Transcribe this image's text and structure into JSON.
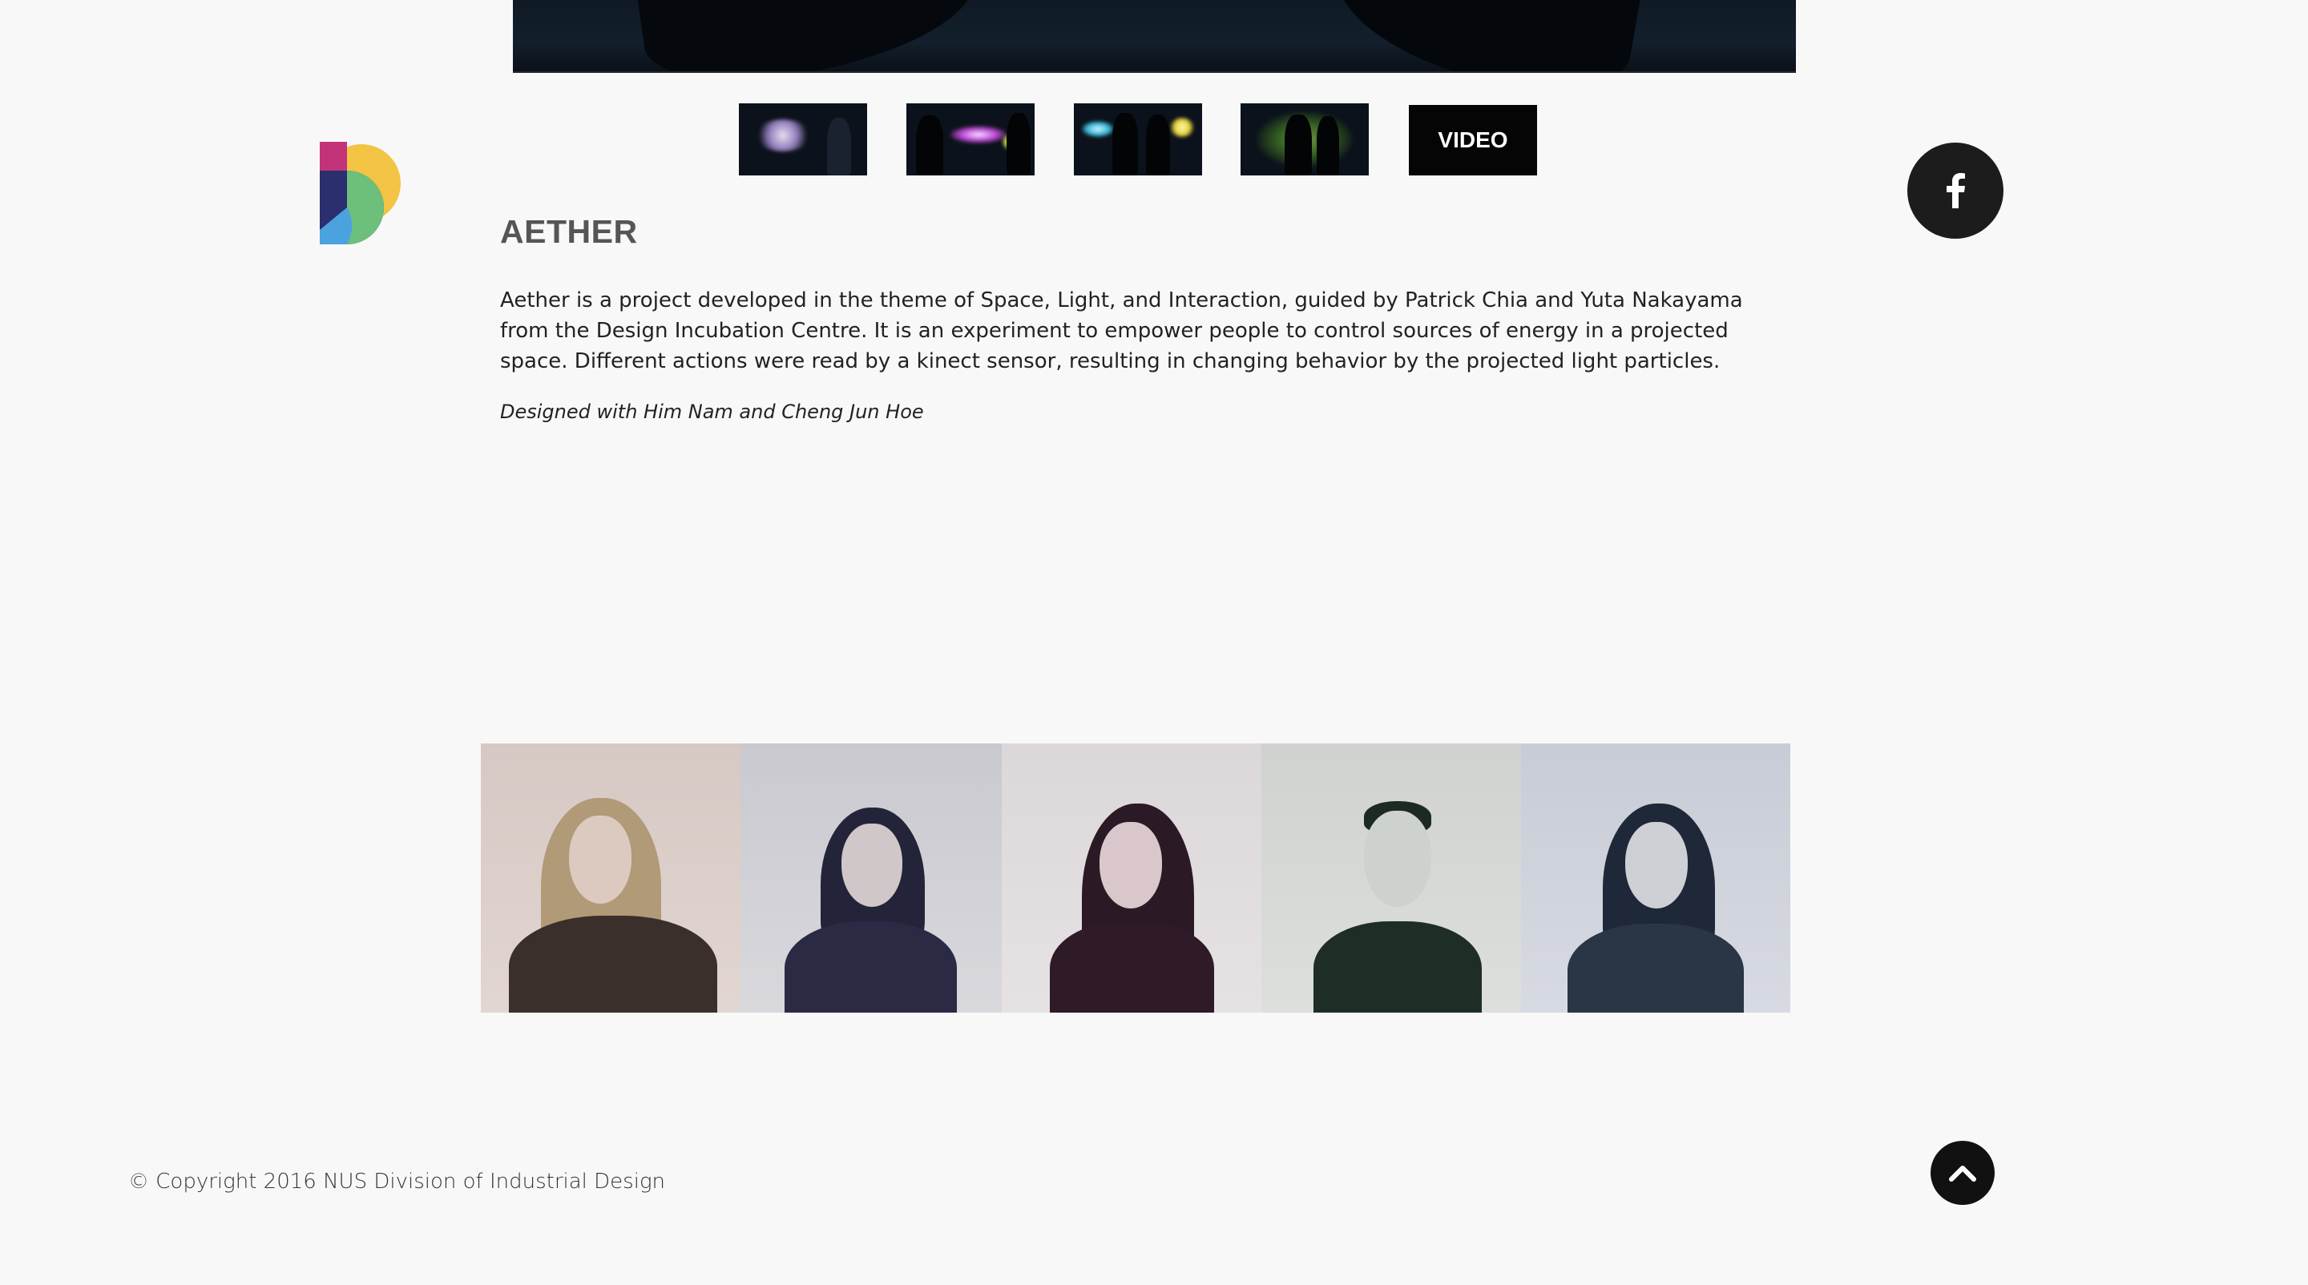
{
  "project": {
    "title": "AETHER",
    "description": "Aether is a project developed in the theme of Space, Light, and Interaction, guided by Patrick Chia and Yuta Nakayama from the Design Incubation Centre. It is an experiment to empower people to control sources of energy in a projected space. Different actions were read by a kinect sensor, resulting in changing behavior by the projected light particles.",
    "credit": "Designed with Him Nam and Cheng Jun Hoe"
  },
  "gallery": {
    "video_label": "VIDEO",
    "thumbnail_count": 4
  },
  "footer": {
    "copyright": "© Copyright 2016 NUS Division of Industrial Design"
  },
  "icons": {
    "social": "facebook-icon",
    "scroll": "chevron-up-icon"
  },
  "colors": {
    "background": "#f8f8f8",
    "title": "#555555",
    "button_dark": "#1c1c1c",
    "logo_yellow": "#f3c443",
    "logo_magenta": "#c2337a",
    "logo_navy": "#2b2f6e",
    "logo_green": "#6dbf7c",
    "logo_blue": "#4aa3df"
  }
}
